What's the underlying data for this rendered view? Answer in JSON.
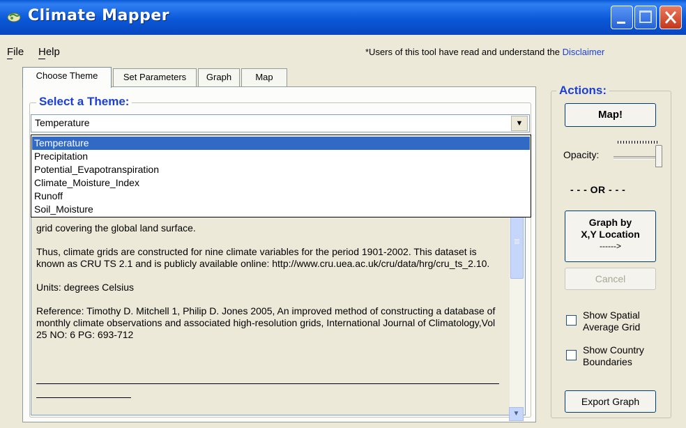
{
  "window": {
    "title": "Climate Mapper"
  },
  "menu": {
    "file": "File",
    "help": "Help"
  },
  "notice": {
    "prefix": "*Users of this tool have read and understand the ",
    "link": "Disclaimer"
  },
  "tabs": [
    {
      "label": "Choose Theme",
      "active": true
    },
    {
      "label": "Set Parameters",
      "active": false
    },
    {
      "label": "Graph",
      "active": false
    },
    {
      "label": "Map",
      "active": false
    }
  ],
  "theme": {
    "group_title": "Select a Theme:",
    "selected": "Temperature",
    "options": [
      "Temperature",
      "Precipitation",
      "Potential_Evapotranspiration",
      "Climate_Moisture_Index",
      "Runoff",
      "Soil_Moisture"
    ]
  },
  "description": {
    "line1": "grid covering the global land surface.",
    "para2": "Thus, climate grids are constructed for nine climate variables for the period 1901-2002. This dataset is known as CRU TS 2.1 and is publicly available online: http://www.cru.uea.ac.uk/cru/data/hrg/cru_ts_2.10.",
    "units": "Units: degrees Celsius",
    "reference": "Reference: Timothy D. Mitchell 1, Philip D. Jones 2005,  An improved method of constructing a database of monthly climate observations and associated high-resolution grids, International Journal of Climatology,Vol 25 NO: 6 PG: 693-712"
  },
  "actions": {
    "title": "Actions:",
    "map_button": "Map!",
    "opacity_label": "Opacity:",
    "opacity_value": 1.0,
    "or_text": "- - - OR - - -",
    "graph_button_line1": "Graph by",
    "graph_button_line2": "X,Y Location",
    "graph_button_line3": "------>",
    "cancel_button": "Cancel",
    "show_spatial_line1": "Show Spatial",
    "show_spatial_line2": "Average Grid",
    "show_spatial_checked": false,
    "show_country_line1": "Show Country",
    "show_country_line2": "Boundaries",
    "show_country_checked": false,
    "export_button": "Export Graph"
  },
  "colors": {
    "titlebar": "#0a58d8",
    "selection": "#316ac5",
    "group_title": "#1b3fd8",
    "link": "#1b3fd8"
  }
}
